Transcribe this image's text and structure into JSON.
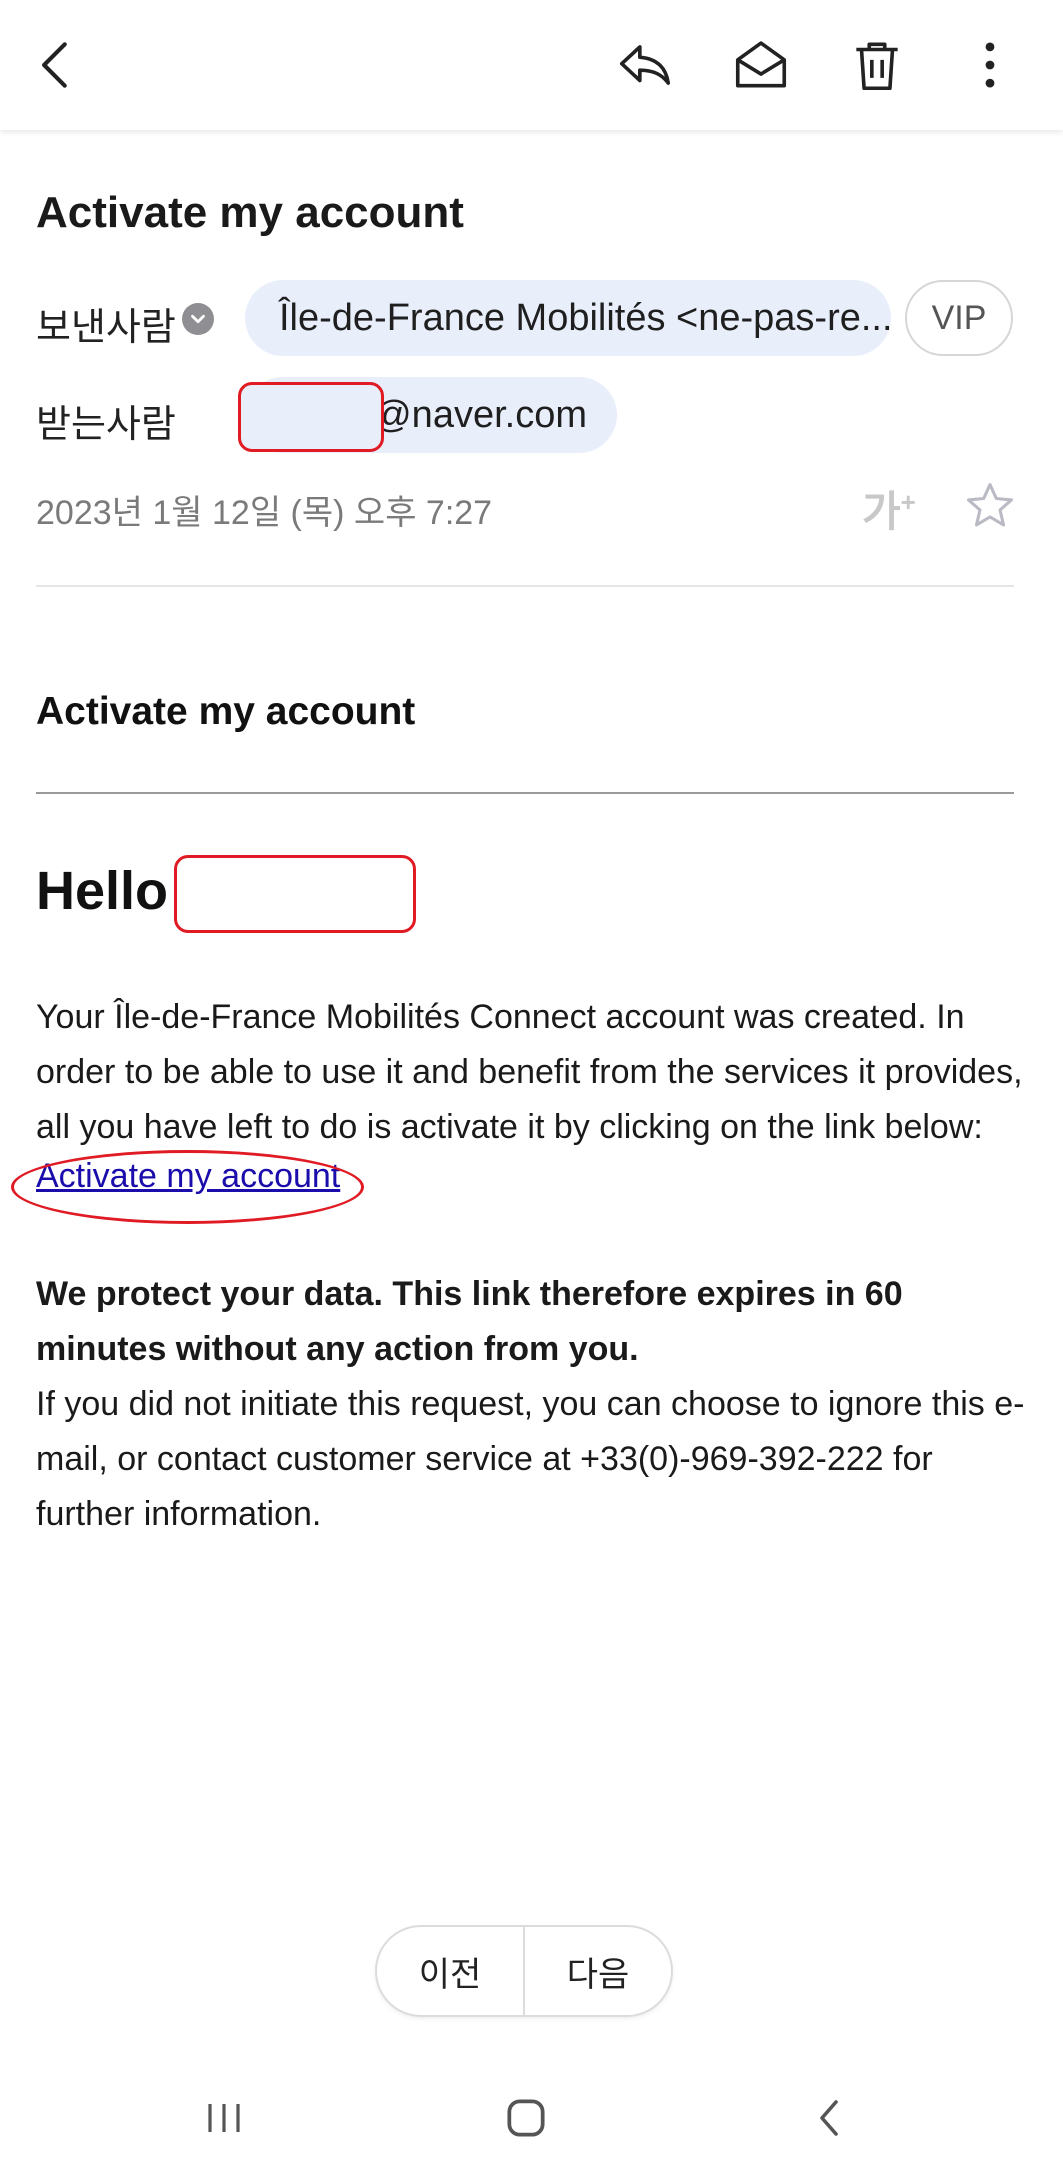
{
  "toolbar": {
    "back_icon": "back-arrow-icon",
    "reply_icon": "reply-icon",
    "mark_read_icon": "open-envelope-icon",
    "delete_icon": "trash-icon",
    "more_icon": "more-vertical-icon"
  },
  "email": {
    "subject": "Activate my account",
    "sender_label": "보낸사람",
    "sender": "Île-de-France Mobilités <ne-pas-re...",
    "vip_label": "VIP",
    "recipient_label": "받는사람",
    "recipient_domain": "@naver.com",
    "date": "2023년 1월 12일 (목) 오후 7:27",
    "font_size_label": "가",
    "font_size_sup": "+"
  },
  "body": {
    "title": "Activate my account",
    "greeting": "Hello",
    "paragraph1": "Your Île-de-France Mobilités Connect account was created. In order to be able to use it and benefit from the services it provides, all you have left to do is activate it by clicking on the link below:",
    "activate_link": "Activate my account",
    "protect_bold": "We protect your data. This link therefore expires in 60 minutes without any action from you.",
    "ignore_text": "If you did not initiate this request, you can choose to ignore this e-mail, or contact customer service at +33(0)-969-392-222 for further information."
  },
  "pager": {
    "prev_label": "이전",
    "next_label": "다음"
  },
  "colors": {
    "chip_bg": "#e9eefb",
    "link": "#1a0dab",
    "redaction": "#e01b24"
  }
}
